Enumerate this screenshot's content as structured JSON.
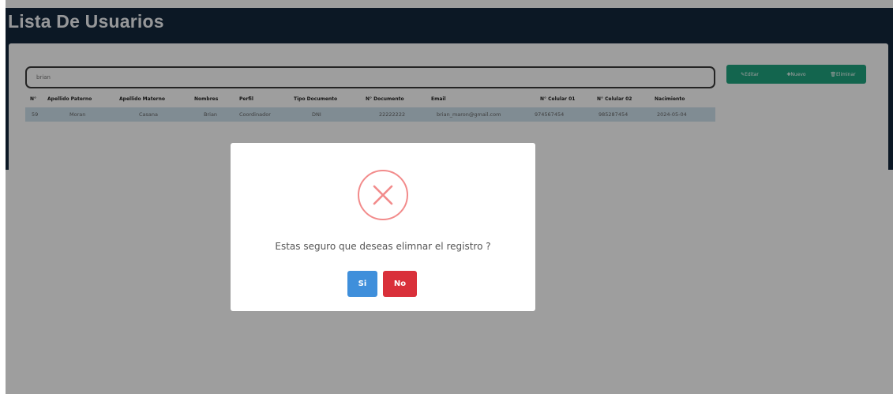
{
  "header": {
    "title": "Lista De Usuarios"
  },
  "search": {
    "value": "brian"
  },
  "toolbar": {
    "edit_label": "✎Editar",
    "new_label": "✚Nuevo",
    "delete_label": "🗑Eliminar"
  },
  "table": {
    "columns": [
      "N°",
      "Apellido Paterno",
      "Apellido Materno",
      "Nombres",
      "Perfil",
      "Tipo Documento",
      "N° Documento",
      "Email",
      "N° Celular 01",
      "N° Celular 02",
      "Nacimiento"
    ],
    "rows": [
      [
        "59",
        "Moran",
        "Casana",
        "Brian",
        "Coordinador",
        "DNI",
        "22222222",
        "brian_maron@gmail.com",
        "974567454",
        "985287454",
        "2024-05-04"
      ]
    ]
  },
  "modal": {
    "icon": "error-x-icon",
    "message": "Estas seguro que deseas elimnar el registro ?",
    "yes_label": "Si",
    "no_label": "No"
  },
  "colors": {
    "topbar": "#14283d",
    "toolbar": "#1fa37e",
    "selected_row": "#cfe2ee",
    "yes_button": "#3f8fdb",
    "no_button": "#d9303a",
    "error_icon": "#f28b8b"
  }
}
